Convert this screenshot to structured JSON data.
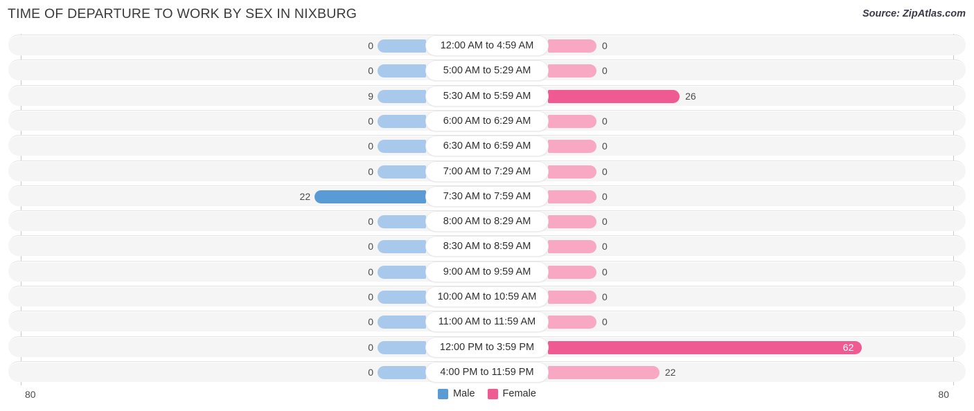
{
  "header": {
    "title": "TIME OF DEPARTURE TO WORK BY SEX IN NIXBURG",
    "source": "Source: ZipAtlas.com"
  },
  "legend": {
    "items": [
      {
        "label": "Male",
        "color": "#5b9bd5"
      },
      {
        "label": "Female",
        "color": "#ef5a92"
      }
    ]
  },
  "axis": {
    "left_tick": "80",
    "right_tick": "80"
  },
  "colors": {
    "male_muted": "#a8c8ec",
    "male_strong": "#5b9bd5",
    "female_muted": "#f9a8c4",
    "female_strong": "#ef5a92",
    "track": "#f5f5f5"
  },
  "chart_data": {
    "type": "bar",
    "subtype": "diverging-butterfly",
    "title": "TIME OF DEPARTURE TO WORK BY SEX IN NIXBURG",
    "xlabel": "",
    "ylabel": "",
    "xlim": [
      80,
      0,
      80
    ],
    "axis_max": 80,
    "grid": false,
    "legend_position": "bottom-center",
    "categories": [
      "12:00 AM to 4:59 AM",
      "5:00 AM to 5:29 AM",
      "5:30 AM to 5:59 AM",
      "6:00 AM to 6:29 AM",
      "6:30 AM to 6:59 AM",
      "7:00 AM to 7:29 AM",
      "7:30 AM to 7:59 AM",
      "8:00 AM to 8:29 AM",
      "8:30 AM to 8:59 AM",
      "9:00 AM to 9:59 AM",
      "10:00 AM to 10:59 AM",
      "11:00 AM to 11:59 AM",
      "12:00 PM to 3:59 PM",
      "4:00 PM to 11:59 PM"
    ],
    "series": [
      {
        "name": "Male",
        "side": "left",
        "color": "#5b9bd5",
        "values": [
          0,
          0,
          9,
          0,
          0,
          0,
          22,
          0,
          0,
          0,
          0,
          0,
          0,
          0
        ],
        "labels": [
          "0",
          "0",
          "9",
          "0",
          "0",
          "0",
          "22",
          "0",
          "0",
          "0",
          "0",
          "0",
          "0",
          "0"
        ]
      },
      {
        "name": "Female",
        "side": "right",
        "color": "#ef5a92",
        "values": [
          0,
          0,
          26,
          0,
          0,
          0,
          0,
          0,
          0,
          0,
          0,
          0,
          62,
          22
        ],
        "labels": [
          "0",
          "0",
          "26",
          "0",
          "0",
          "0",
          "0",
          "0",
          "0",
          "0",
          "0",
          "0",
          "62",
          "22"
        ]
      }
    ]
  }
}
